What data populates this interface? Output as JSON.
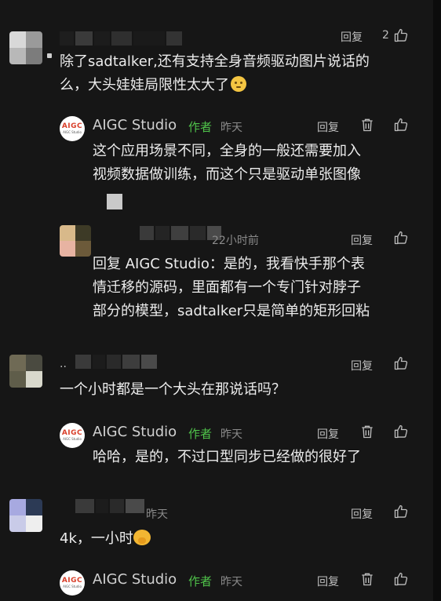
{
  "comments": [
    {
      "text_line1": "除了sadtalker,还有支持全身音频驱动图片说话的",
      "text_line2": "么，大头娃娃局限性太大了",
      "reply_label": "回复",
      "likes": "2",
      "reply": {
        "author": "AIGC Studio",
        "author_tag": "作者",
        "time": "昨天",
        "reply_label": "回复",
        "text_line1": "这个应用场景不同，全身的一般还需要加入",
        "text_line2": "视频数据做训练，而这个只是驱动单张图像"
      },
      "reply2": {
        "time": "22小时前",
        "reply_label": "回复",
        "text_line1": "回复 AIGC Studio：是的，我看快手那个表",
        "text_line2": "情迁移的源码，里面都有一个专门针对脖子",
        "text_line3": "部分的模型，sadtalker只是简单的矩形回粘"
      }
    },
    {
      "name_prefix": "..",
      "text_line1": "一个小时都是一个大头在那说话吗？",
      "reply_label": "回复",
      "reply": {
        "author": "AIGC Studio",
        "author_tag": "作者",
        "time": "昨天",
        "reply_label": "回复",
        "text_line1": "哈哈，是的，不过口型同步已经做的很好了"
      }
    },
    {
      "time": "昨天",
      "text_line1": "4k，一小时",
      "reply_label": "回复",
      "reply": {
        "author": "AIGC Studio",
        "author_tag": "作者",
        "time": "昨天",
        "reply_label": "回复"
      }
    }
  ],
  "logo": {
    "line1": "AIGC",
    "line2": "AIGC Studio"
  },
  "icons": {
    "like": "thumbs-up-icon",
    "delete": "trash-icon"
  },
  "colors": {
    "background": "#161616",
    "author_tag": "#4fc24a",
    "text": "#ececec",
    "meta": "#8a8a8a"
  }
}
